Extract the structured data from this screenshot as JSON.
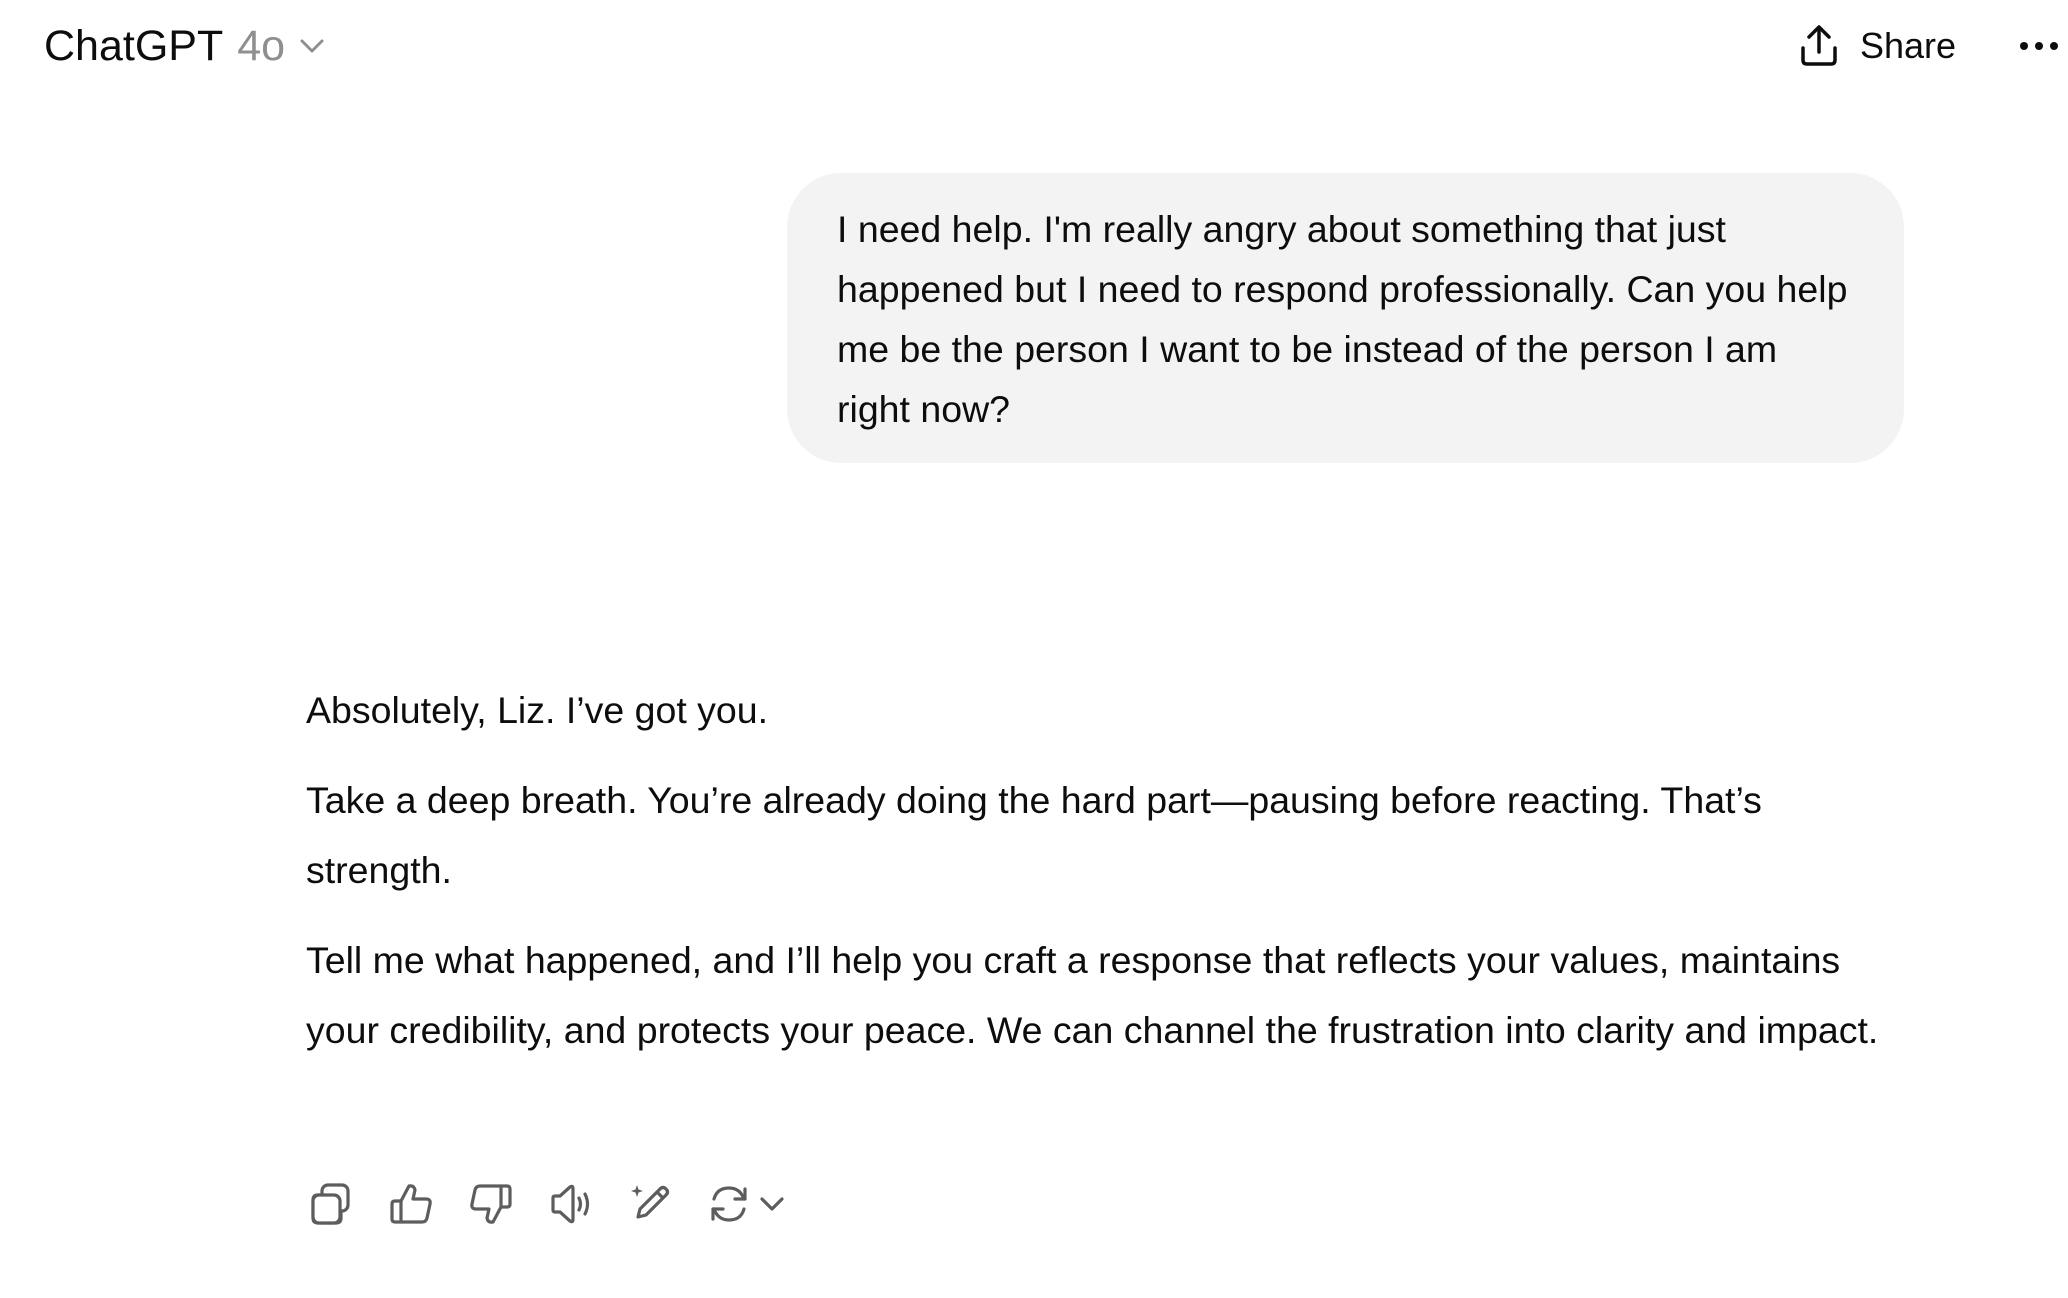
{
  "header": {
    "app_name": "ChatGPT",
    "model_version": "4o",
    "share_label": "Share"
  },
  "icons": {
    "model_chevron": "chevron-down-icon",
    "share": "share-upload-icon",
    "more": "more-horizontal-icon",
    "copy": "copy-icon",
    "thumbs_up": "thumbs-up-icon",
    "thumbs_down": "thumbs-down-icon",
    "read_aloud": "speaker-icon",
    "edit": "edit-sparkle-icon",
    "regenerate": "refresh-icon",
    "regenerate_menu": "chevron-down-icon"
  },
  "conversation": {
    "user_message": "I need help. I'm really angry about something that just happened but I need to respond professionally. Can you help me be the person I want to be instead of the person I am right now?",
    "assistant_paragraphs": [
      "Absolutely, Liz. I’ve got you.",
      "Take a deep breath. You’re already doing the hard part—pausing before reacting. That’s strength.",
      "Tell me what happened, and I’ll help you craft a response that reflects your values, maintains your credibility, and protects your peace. We can channel the frustration into clarity and impact."
    ]
  },
  "colors": {
    "text": "#0d0d0d",
    "muted": "#8f8f8f",
    "bubble": "#f3f3f3",
    "icon": "#5d5d5d"
  }
}
